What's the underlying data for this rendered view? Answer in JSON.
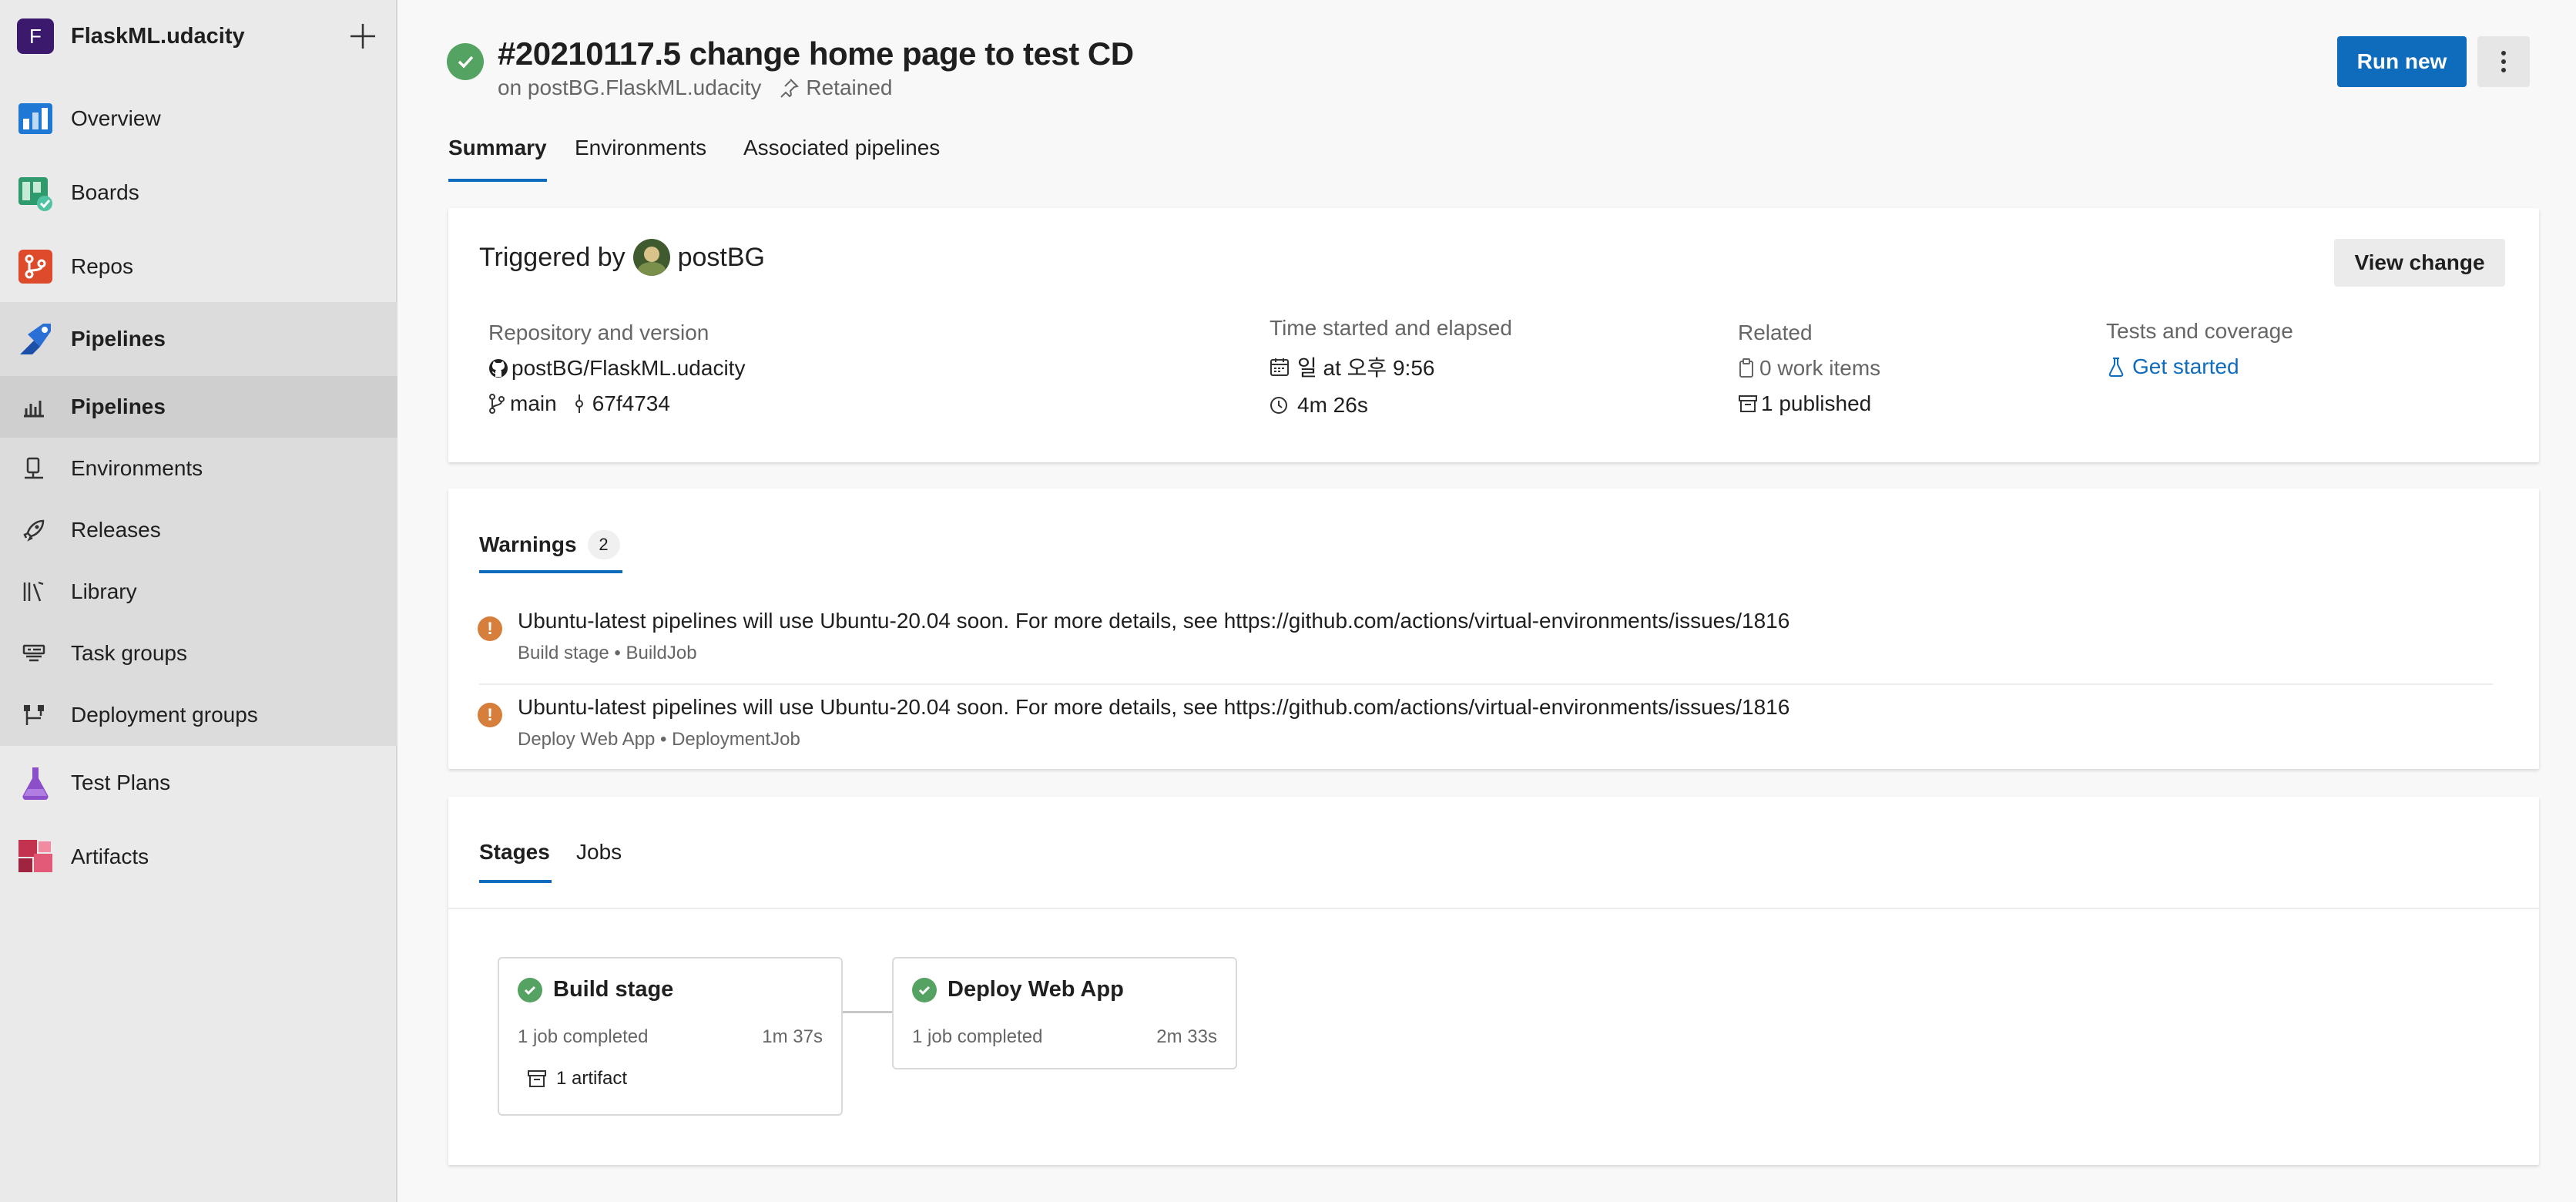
{
  "project": {
    "initial": "F",
    "name": "FlaskML.udacity"
  },
  "nav": {
    "overview": "Overview",
    "boards": "Boards",
    "repos": "Repos",
    "pipelines": "Pipelines",
    "sub": {
      "pipelines": "Pipelines",
      "environments": "Environments",
      "releases": "Releases",
      "library": "Library",
      "task_groups": "Task groups",
      "deployment_groups": "Deployment groups"
    },
    "test_plans": "Test Plans",
    "artifacts": "Artifacts"
  },
  "header": {
    "title": "#20210117.5 change home page to test CD",
    "subtitle": "on postBG.FlaskML.udacity",
    "retained": "Retained",
    "run_new": "Run new"
  },
  "tabs": {
    "summary": "Summary",
    "environments": "Environments",
    "associated": "Associated pipelines"
  },
  "trigger": {
    "label": "Triggered by",
    "user": "postBG",
    "view_change": "View change",
    "repo_heading": "Repository and version",
    "repo": "postBG/FlaskML.udacity",
    "branch": "main",
    "commit": "67f4734",
    "time_heading": "Time started and elapsed",
    "started": "일 at 오후 9:56",
    "elapsed": "4m 26s",
    "related_heading": "Related",
    "work_items": "0 work items",
    "published": "1 published",
    "tests_heading": "Tests and coverage",
    "get_started": "Get started"
  },
  "warnings": {
    "tab": "Warnings",
    "count": "2",
    "items": [
      {
        "message": "Ubuntu-latest pipelines will use Ubuntu-20.04 soon. For more details, see https://github.com/actions/virtual-environments/issues/1816",
        "source": "Build stage • BuildJob"
      },
      {
        "message": "Ubuntu-latest pipelines will use Ubuntu-20.04 soon. For more details, see https://github.com/actions/virtual-environments/issues/1816",
        "source": "Deploy Web App • DeploymentJob"
      }
    ]
  },
  "stages": {
    "tab_stages": "Stages",
    "tab_jobs": "Jobs",
    "items": [
      {
        "name": "Build stage",
        "status": "1 job completed",
        "duration": "1m 37s",
        "artifact": "1 artifact"
      },
      {
        "name": "Deploy Web App",
        "status": "1 job completed",
        "duration": "2m 33s"
      }
    ]
  },
  "colors": {
    "accent": "#0f6cbd",
    "success": "#55a362",
    "warning": "#d67f3c"
  }
}
